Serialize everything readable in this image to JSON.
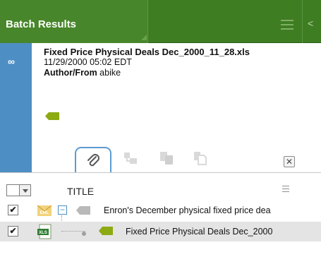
{
  "header": {
    "title": "Batch Results"
  },
  "detail": {
    "link_glyph": "∞",
    "file_name": "Fixed Price Physical Deals Dec_2000_11_28.xls",
    "date": "11/29/2000 05:02 EDT",
    "author_label": "Author/From",
    "author_value": "abike",
    "close_glyph": "✕"
  },
  "list": {
    "title_column": "TITLE",
    "rows": [
      {
        "checked_glyph": "✔",
        "type_label": "EML",
        "expander": "−",
        "title": "Enron's December physical fixed price dea"
      },
      {
        "checked_glyph": "✔",
        "type_label": "XLS",
        "title": "Fixed Price Physical Deals Dec_2000"
      }
    ]
  },
  "colors": {
    "header_green": "#3f7d22",
    "stripe_blue": "#4d8fc4",
    "tag_green": "#8caa12"
  }
}
